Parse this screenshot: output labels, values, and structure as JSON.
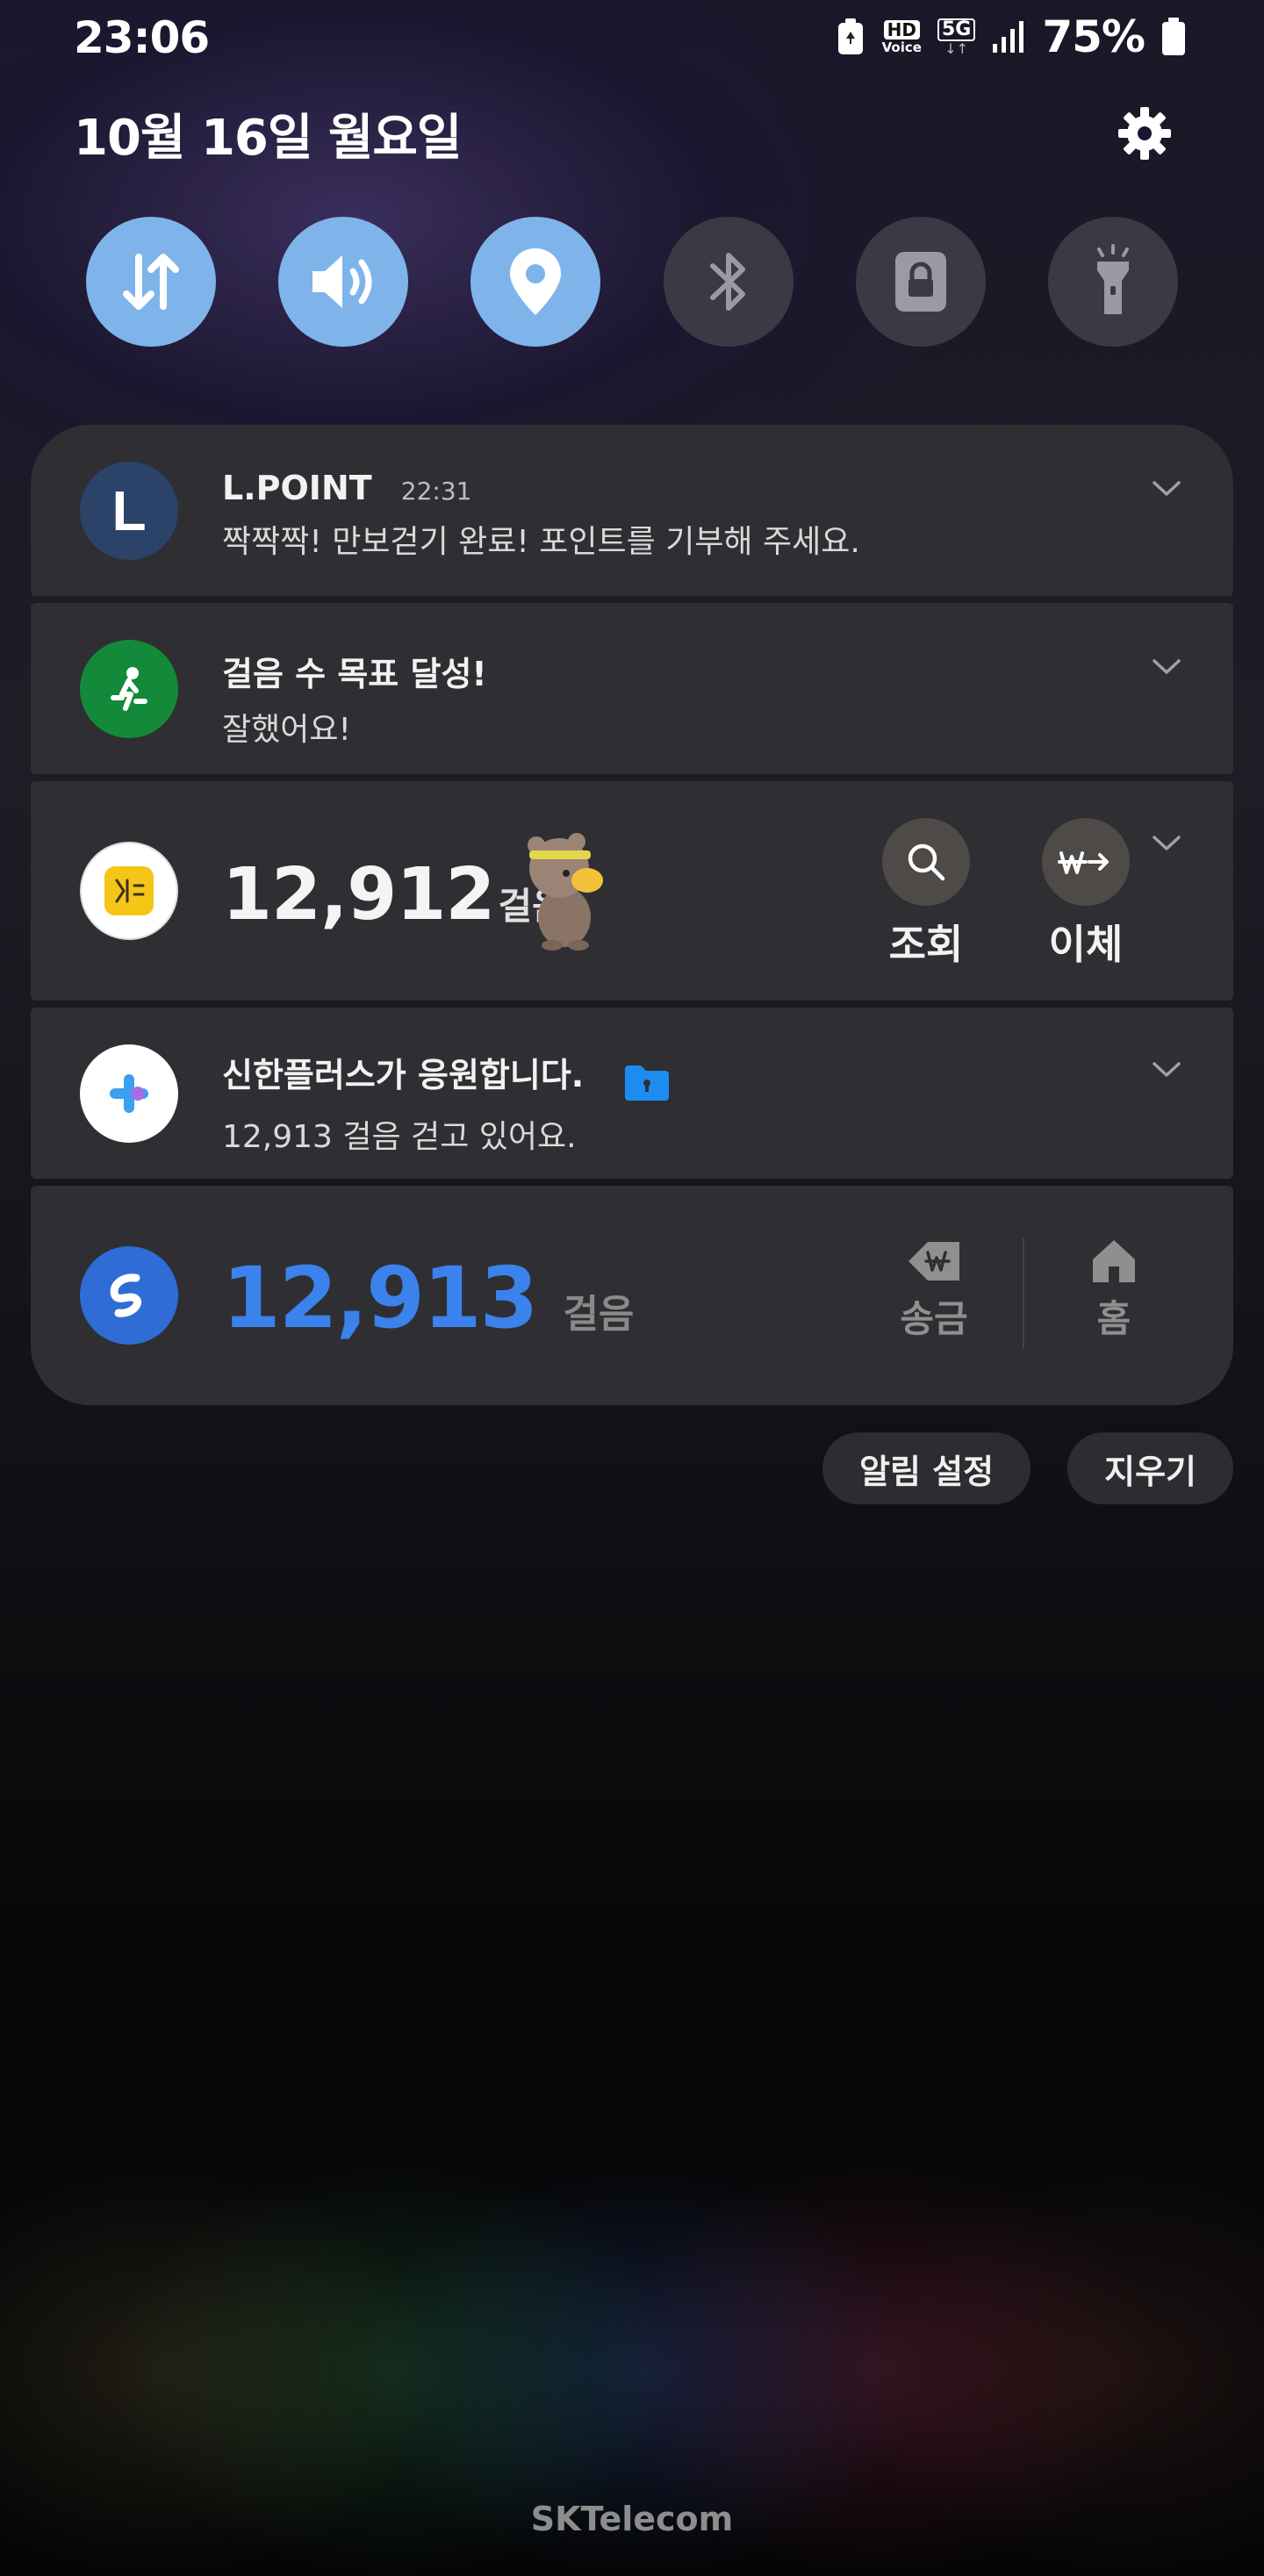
{
  "status_bar": {
    "time": "23:06",
    "battery_percent": "75%",
    "hd_label": "HD",
    "voice_label": "Voice",
    "network_label": "5G",
    "icons": [
      "recycle-icon",
      "hd-voice-icon",
      "5g-icon",
      "signal-icon",
      "battery-icon"
    ]
  },
  "header": {
    "date": "10월 16일 월요일"
  },
  "quick_toggles": [
    {
      "name": "mobile-data",
      "icon": "data-arrows-icon",
      "state": "on"
    },
    {
      "name": "sound",
      "icon": "speaker-icon",
      "state": "on"
    },
    {
      "name": "location",
      "icon": "location-pin-icon",
      "state": "on"
    },
    {
      "name": "bluetooth",
      "icon": "bluetooth-icon",
      "state": "off"
    },
    {
      "name": "secure-folder",
      "icon": "lock-icon",
      "state": "off"
    },
    {
      "name": "flashlight",
      "icon": "flashlight-icon",
      "state": "off"
    }
  ],
  "notifications": {
    "lpoint": {
      "icon_letter": "L",
      "title": "L.POINT",
      "time": "22:31",
      "text": "짝짝짝! 만보걷기 완료! 포인트를 기부해 주세요."
    },
    "walk_goal": {
      "title": "걸음 수 목표 달성!",
      "text": "잘했어요!"
    },
    "kb": {
      "steps": "12,912",
      "unit": "걸음",
      "action_search": "조회",
      "action_transfer": "이체"
    },
    "shinhan": {
      "title": "신한플러스가 응원합니다.",
      "text": "12,913 걸음 걷고 있어요."
    },
    "toss": {
      "steps": "12,913",
      "unit": "걸음",
      "action_send": "송금",
      "action_home": "홈"
    }
  },
  "buttons": {
    "notification_settings": "알림 설정",
    "clear": "지우기"
  },
  "carrier": "SKTelecom",
  "colors": {
    "toggle_on": "#7eb4ea",
    "toggle_off": "#3a3a44",
    "card_bg": "#2f2f33",
    "toss_blue": "#3b82ec"
  }
}
